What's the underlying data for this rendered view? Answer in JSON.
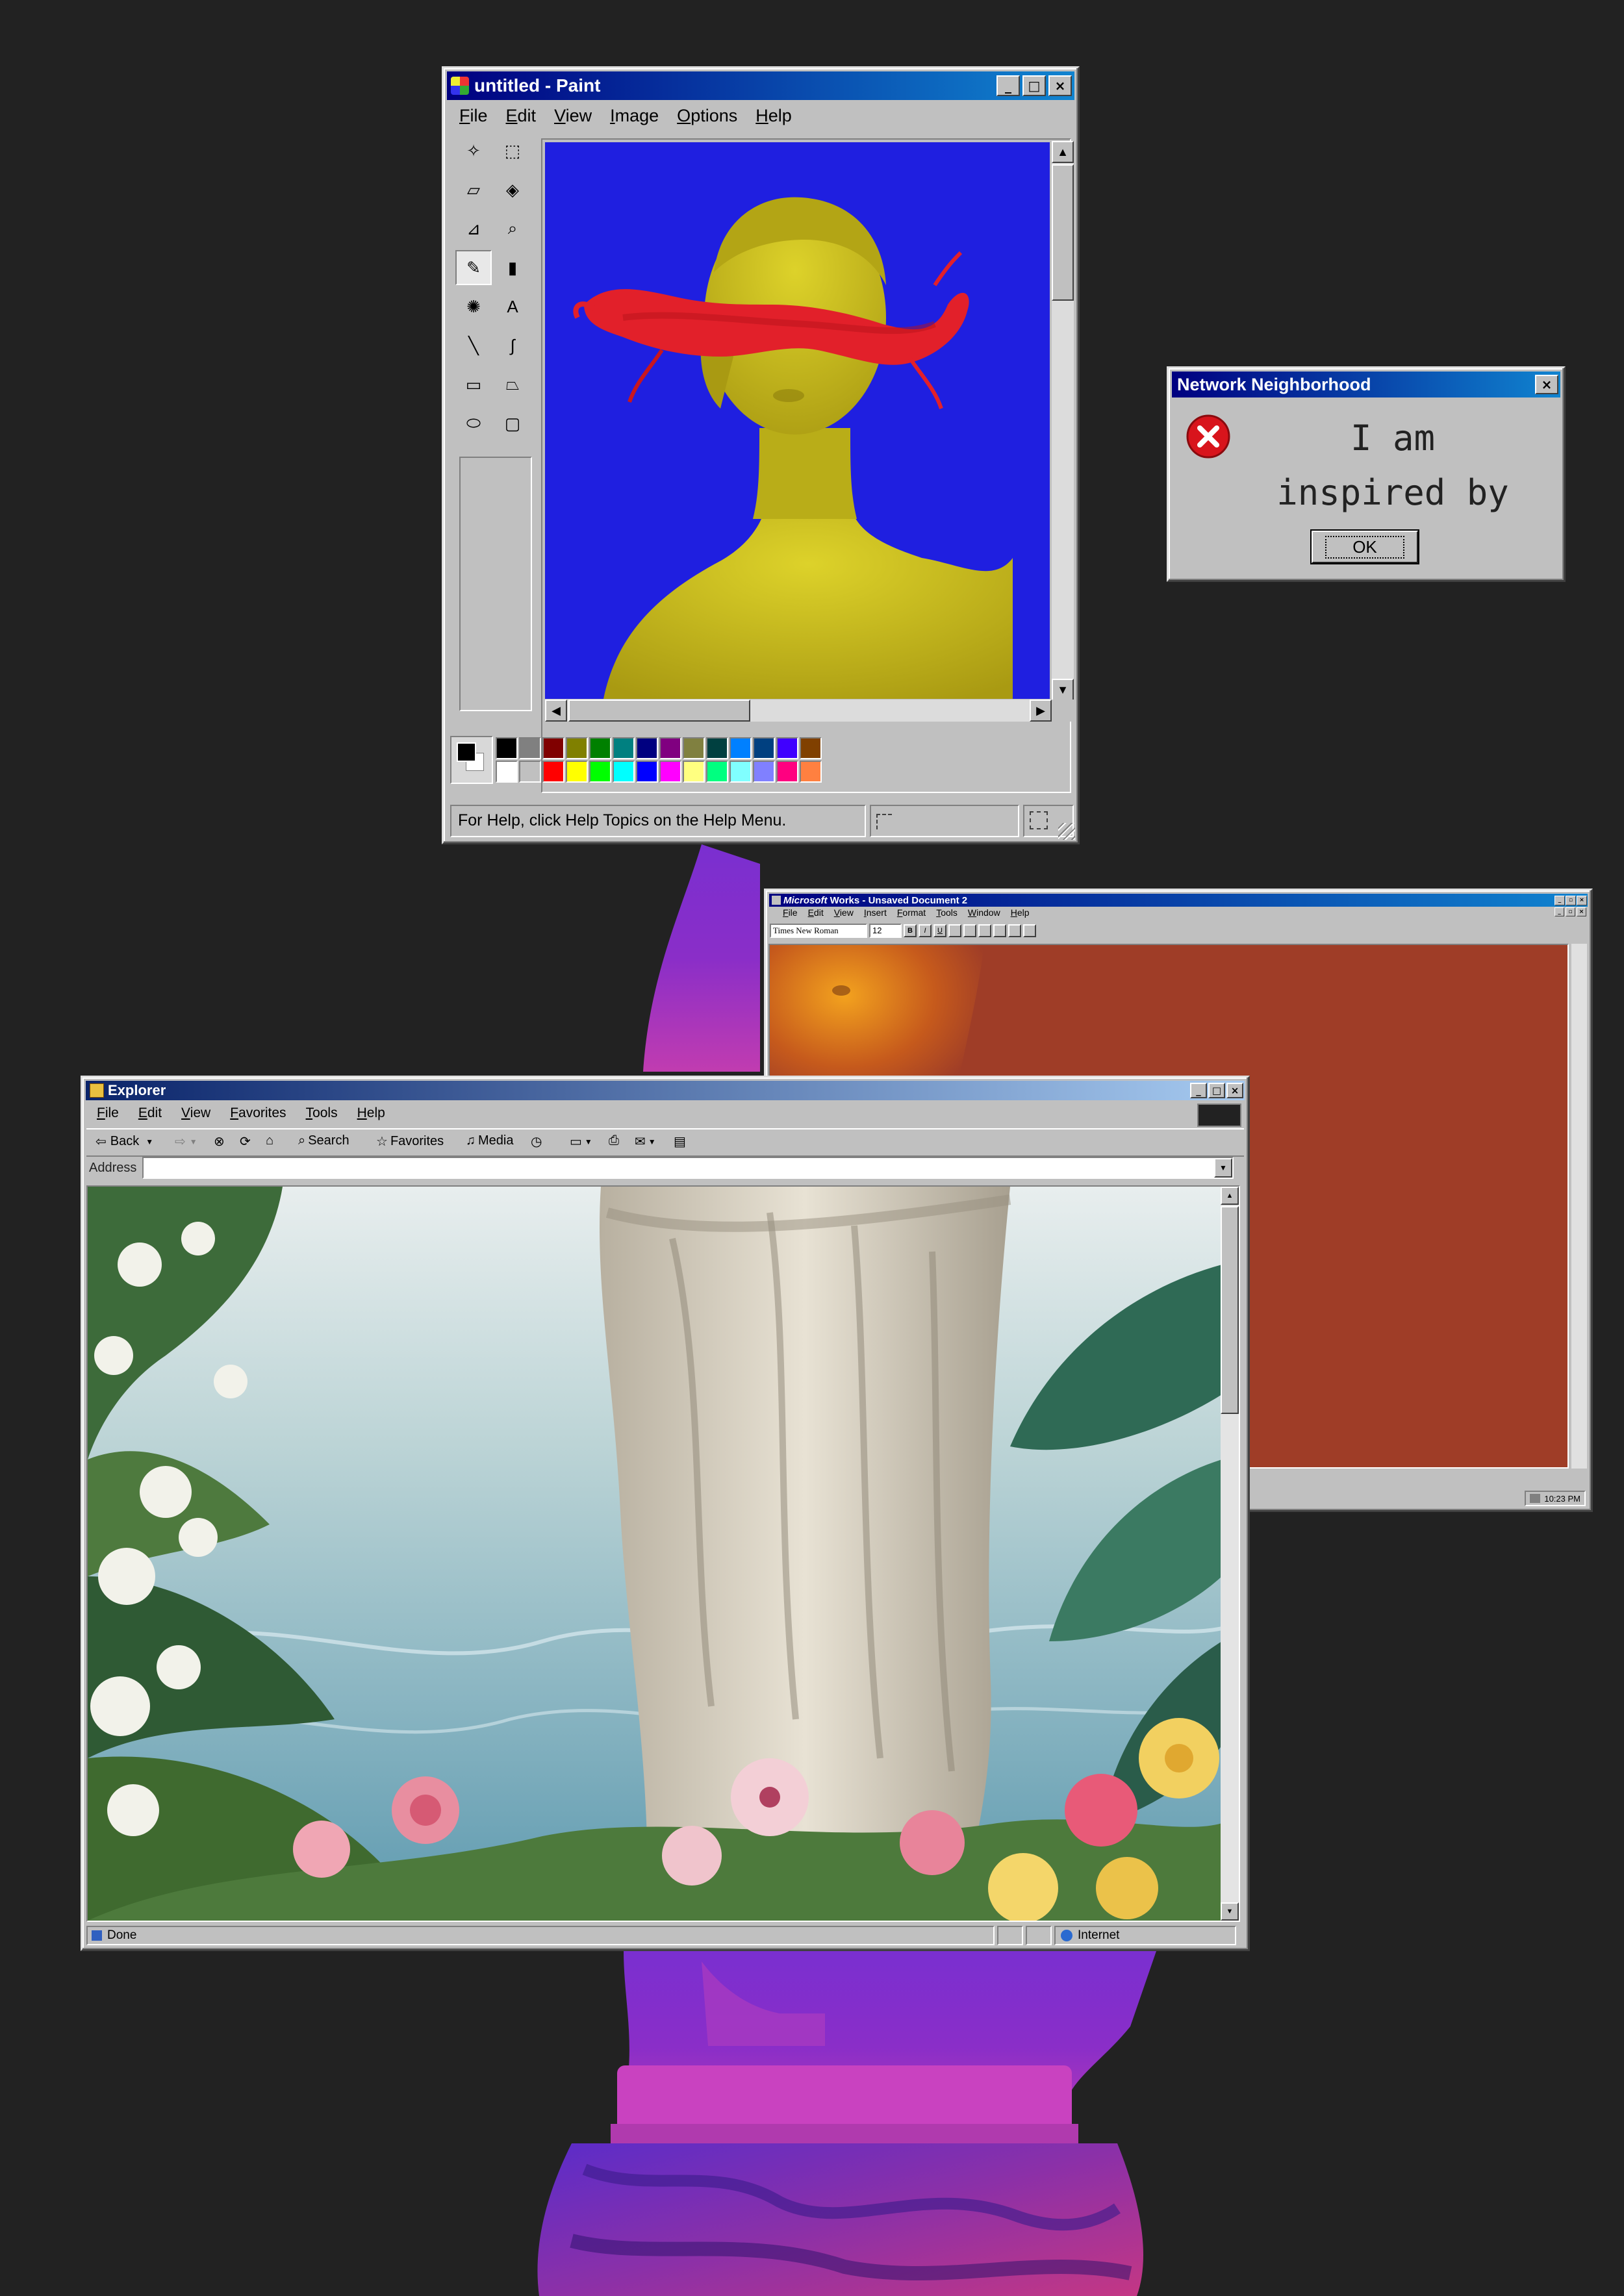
{
  "paint": {
    "title": "untitled - Paint",
    "menu": [
      "File",
      "Edit",
      "View",
      "Image",
      "Options",
      "Help"
    ],
    "status": "For Help, click Help Topics on the Help Menu.",
    "palette_top": [
      "#000000",
      "#808080",
      "#800000",
      "#808000",
      "#008000",
      "#008080",
      "#000080",
      "#800080",
      "#808040",
      "#004040",
      "#0080ff",
      "#004080",
      "#4000ff",
      "#804000"
    ],
    "palette_bottom": [
      "#ffffff",
      "#c0c0c0",
      "#ff0000",
      "#ffff00",
      "#00ff00",
      "#00ffff",
      "#0000ff",
      "#ff00ff",
      "#ffff80",
      "#00ff80",
      "#80ffff",
      "#8080ff",
      "#ff0080",
      "#ff8040"
    ],
    "tools": [
      "free-select-icon",
      "rect-select-icon",
      "eraser-icon",
      "fill-icon",
      "picker-icon",
      "magnifier-icon",
      "pencil-icon",
      "brush-icon",
      "airbrush-icon",
      "text-icon",
      "line-icon",
      "curve-icon",
      "rectangle-icon",
      "polygon-icon",
      "ellipse-icon",
      "rounded-rect-icon"
    ]
  },
  "network_dialog": {
    "title": "Network Neighborhood",
    "message_line1": "I am",
    "message_line2": "inspired by",
    "ok_label": "OK",
    "icon": "error-icon"
  },
  "works": {
    "title_brand": "Microsoft",
    "title_rest": " Works - Unsaved Document 2",
    "menu": [
      "File",
      "Edit",
      "View",
      "Insert",
      "Format",
      "Tools",
      "Window",
      "Help"
    ],
    "font_name": "Times New Roman",
    "font_size": "12",
    "clock": "10:23 PM"
  },
  "explorer": {
    "title": "Explorer",
    "menu": [
      "File",
      "Edit",
      "View",
      "Favorites",
      "Tools",
      "Help"
    ],
    "back_label": "Back",
    "search_label": "Search",
    "favorites_label": "Favorites",
    "media_label": "Media",
    "address_label": "Address",
    "address_value": "",
    "status_left": "Done",
    "status_zone": "Internet"
  },
  "colors": {
    "desktop": "#222222",
    "paint_canvas": "#1f1fe0",
    "statue_yellow": "#c9bd1c",
    "works_doc": "#9f3d27",
    "title_navy": "#000080"
  }
}
